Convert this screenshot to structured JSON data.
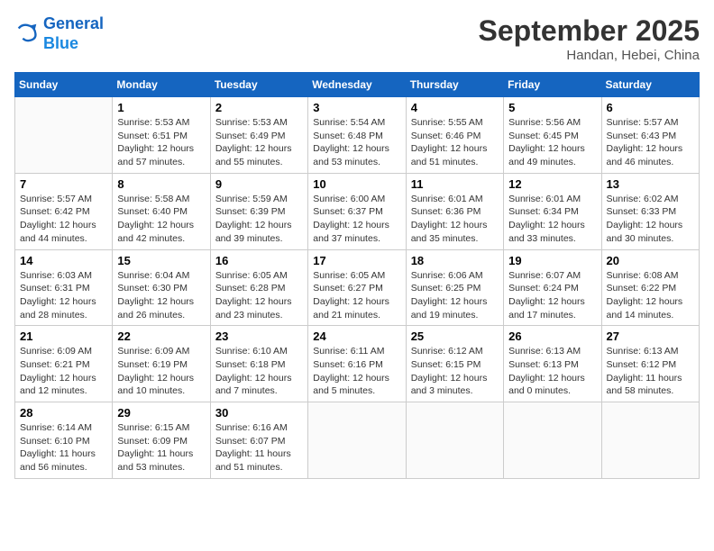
{
  "header": {
    "logo_line1": "General",
    "logo_line2": "Blue",
    "month": "September 2025",
    "location": "Handan, Hebei, China"
  },
  "weekdays": [
    "Sunday",
    "Monday",
    "Tuesday",
    "Wednesday",
    "Thursday",
    "Friday",
    "Saturday"
  ],
  "weeks": [
    [
      {
        "num": "",
        "info": ""
      },
      {
        "num": "1",
        "info": "Sunrise: 5:53 AM\nSunset: 6:51 PM\nDaylight: 12 hours\nand 57 minutes."
      },
      {
        "num": "2",
        "info": "Sunrise: 5:53 AM\nSunset: 6:49 PM\nDaylight: 12 hours\nand 55 minutes."
      },
      {
        "num": "3",
        "info": "Sunrise: 5:54 AM\nSunset: 6:48 PM\nDaylight: 12 hours\nand 53 minutes."
      },
      {
        "num": "4",
        "info": "Sunrise: 5:55 AM\nSunset: 6:46 PM\nDaylight: 12 hours\nand 51 minutes."
      },
      {
        "num": "5",
        "info": "Sunrise: 5:56 AM\nSunset: 6:45 PM\nDaylight: 12 hours\nand 49 minutes."
      },
      {
        "num": "6",
        "info": "Sunrise: 5:57 AM\nSunset: 6:43 PM\nDaylight: 12 hours\nand 46 minutes."
      }
    ],
    [
      {
        "num": "7",
        "info": "Sunrise: 5:57 AM\nSunset: 6:42 PM\nDaylight: 12 hours\nand 44 minutes."
      },
      {
        "num": "8",
        "info": "Sunrise: 5:58 AM\nSunset: 6:40 PM\nDaylight: 12 hours\nand 42 minutes."
      },
      {
        "num": "9",
        "info": "Sunrise: 5:59 AM\nSunset: 6:39 PM\nDaylight: 12 hours\nand 39 minutes."
      },
      {
        "num": "10",
        "info": "Sunrise: 6:00 AM\nSunset: 6:37 PM\nDaylight: 12 hours\nand 37 minutes."
      },
      {
        "num": "11",
        "info": "Sunrise: 6:01 AM\nSunset: 6:36 PM\nDaylight: 12 hours\nand 35 minutes."
      },
      {
        "num": "12",
        "info": "Sunrise: 6:01 AM\nSunset: 6:34 PM\nDaylight: 12 hours\nand 33 minutes."
      },
      {
        "num": "13",
        "info": "Sunrise: 6:02 AM\nSunset: 6:33 PM\nDaylight: 12 hours\nand 30 minutes."
      }
    ],
    [
      {
        "num": "14",
        "info": "Sunrise: 6:03 AM\nSunset: 6:31 PM\nDaylight: 12 hours\nand 28 minutes."
      },
      {
        "num": "15",
        "info": "Sunrise: 6:04 AM\nSunset: 6:30 PM\nDaylight: 12 hours\nand 26 minutes."
      },
      {
        "num": "16",
        "info": "Sunrise: 6:05 AM\nSunset: 6:28 PM\nDaylight: 12 hours\nand 23 minutes."
      },
      {
        "num": "17",
        "info": "Sunrise: 6:05 AM\nSunset: 6:27 PM\nDaylight: 12 hours\nand 21 minutes."
      },
      {
        "num": "18",
        "info": "Sunrise: 6:06 AM\nSunset: 6:25 PM\nDaylight: 12 hours\nand 19 minutes."
      },
      {
        "num": "19",
        "info": "Sunrise: 6:07 AM\nSunset: 6:24 PM\nDaylight: 12 hours\nand 17 minutes."
      },
      {
        "num": "20",
        "info": "Sunrise: 6:08 AM\nSunset: 6:22 PM\nDaylight: 12 hours\nand 14 minutes."
      }
    ],
    [
      {
        "num": "21",
        "info": "Sunrise: 6:09 AM\nSunset: 6:21 PM\nDaylight: 12 hours\nand 12 minutes."
      },
      {
        "num": "22",
        "info": "Sunrise: 6:09 AM\nSunset: 6:19 PM\nDaylight: 12 hours\nand 10 minutes."
      },
      {
        "num": "23",
        "info": "Sunrise: 6:10 AM\nSunset: 6:18 PM\nDaylight: 12 hours\nand 7 minutes."
      },
      {
        "num": "24",
        "info": "Sunrise: 6:11 AM\nSunset: 6:16 PM\nDaylight: 12 hours\nand 5 minutes."
      },
      {
        "num": "25",
        "info": "Sunrise: 6:12 AM\nSunset: 6:15 PM\nDaylight: 12 hours\nand 3 minutes."
      },
      {
        "num": "26",
        "info": "Sunrise: 6:13 AM\nSunset: 6:13 PM\nDaylight: 12 hours\nand 0 minutes."
      },
      {
        "num": "27",
        "info": "Sunrise: 6:13 AM\nSunset: 6:12 PM\nDaylight: 11 hours\nand 58 minutes."
      }
    ],
    [
      {
        "num": "28",
        "info": "Sunrise: 6:14 AM\nSunset: 6:10 PM\nDaylight: 11 hours\nand 56 minutes."
      },
      {
        "num": "29",
        "info": "Sunrise: 6:15 AM\nSunset: 6:09 PM\nDaylight: 11 hours\nand 53 minutes."
      },
      {
        "num": "30",
        "info": "Sunrise: 6:16 AM\nSunset: 6:07 PM\nDaylight: 11 hours\nand 51 minutes."
      },
      {
        "num": "",
        "info": ""
      },
      {
        "num": "",
        "info": ""
      },
      {
        "num": "",
        "info": ""
      },
      {
        "num": "",
        "info": ""
      }
    ]
  ]
}
